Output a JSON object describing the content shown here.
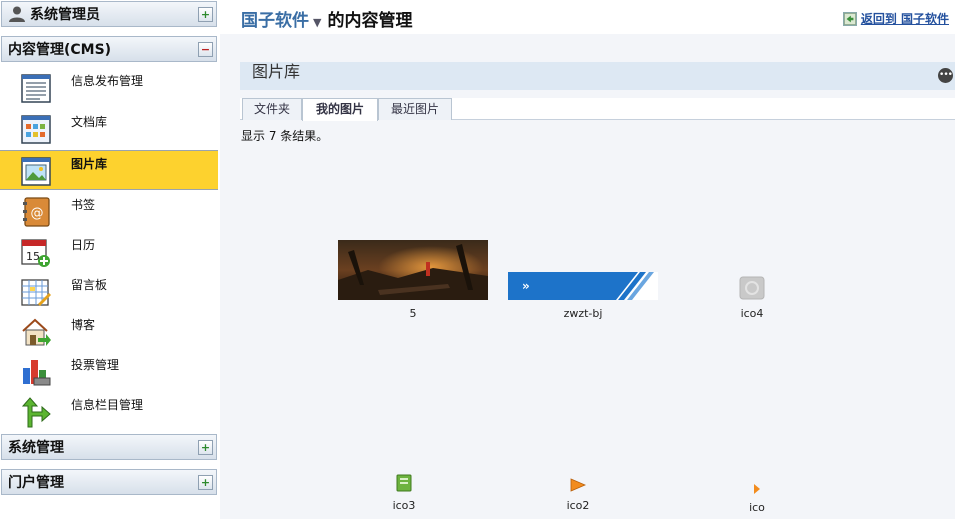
{
  "sidebar": {
    "admin_label": "系统管理员",
    "cms_label": "内容管理(CMS)",
    "items": [
      {
        "label": "信息发布管理",
        "icon": "document-list-icon"
      },
      {
        "label": "文档库",
        "icon": "document-library-icon"
      },
      {
        "label": "图片库",
        "icon": "image-gallery-icon",
        "active": true
      },
      {
        "label": "书签",
        "icon": "bookmark-book-icon"
      },
      {
        "label": "日历",
        "icon": "calendar-icon"
      },
      {
        "label": "留言板",
        "icon": "message-board-icon"
      },
      {
        "label": "博客",
        "icon": "blog-house-icon"
      },
      {
        "label": "投票管理",
        "icon": "poll-chart-icon"
      },
      {
        "label": "信息栏目管理",
        "icon": "column-arrow-icon"
      }
    ],
    "system_label": "系统管理",
    "portal_label": "门户管理"
  },
  "header": {
    "site_name": "国子软件",
    "suffix": "的内容管理",
    "back_link": "返回到 国子软件"
  },
  "gallery": {
    "title": "图片库",
    "tabs": [
      "文件夹",
      "我的图片",
      "最近图片"
    ],
    "active_tab": "我的图片",
    "result_text": "显示 7 条结果。",
    "images": [
      {
        "caption": "5"
      },
      {
        "caption": "zwzt-bj"
      },
      {
        "caption": "ico4"
      },
      {
        "caption": "ico3"
      },
      {
        "caption": "ico2"
      },
      {
        "caption": "ico"
      }
    ]
  },
  "colors": {
    "active_item_bg": "#fdd22e",
    "link_blue": "#24519e",
    "site_blue": "#3a6ea5",
    "banner_blue": "#1d73c9"
  }
}
